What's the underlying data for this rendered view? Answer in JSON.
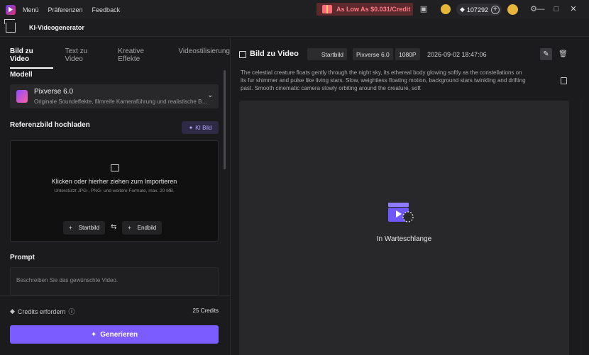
{
  "titlebar": {
    "menu": [
      "Menü",
      "Präferenzen",
      "Feedback"
    ],
    "promo_text": "As Low As $0.031/Credit",
    "credits_balance": "107292"
  },
  "nav": {
    "title": "KI-Videogenerator"
  },
  "left": {
    "tabs": [
      {
        "label": "Bild zu Video",
        "active": true
      },
      {
        "label": "Text zu Video",
        "active": false
      },
      {
        "label": "Kreative Effekte",
        "active": false
      },
      {
        "label": "Videostilisierung",
        "active": false
      }
    ],
    "model_section": "Modell",
    "model_name": "Pixverse 6.0",
    "model_desc": "Originale Soundeffekte, filmreife Kameraführung und realistische Bewegungen",
    "reference_section": "Referenzbild hochladen",
    "ki_button": "KI Bild",
    "upload_title": "Klicken oder hierher ziehen zum Importieren",
    "upload_sub": "Unterstützt JPG-, PNG- und weitere Formate, max. 20 MB.",
    "start_frame": "Startbild",
    "end_frame": "Endbild",
    "prompt_section": "Prompt",
    "prompt_placeholder": "Beschreiben Sie das gewünschte Video.",
    "credits_label": "Credits erfordern",
    "credits_value": "25 Credits",
    "generate_label": "Generieren"
  },
  "right": {
    "title": "Bild zu Video",
    "chips": [
      "Startbild",
      "Pixverse 6.0",
      "1080P"
    ],
    "datetime": "2026-09-02 18:47:06",
    "description": "The celestial creature floats gently through the night sky, its ethereal body glowing softly as the constellations on its fur shimmer and pulse like living stars. Slow, weightless floating motion, background stars twinkling and drifting past. Smooth cinematic camera slowly orbiting around the creature, soft",
    "status": "In Warteschlange"
  },
  "colors": {
    "accent": "#7b5cff",
    "promo_bg": "#5c2a2c",
    "promo_text": "#ff7a88"
  }
}
